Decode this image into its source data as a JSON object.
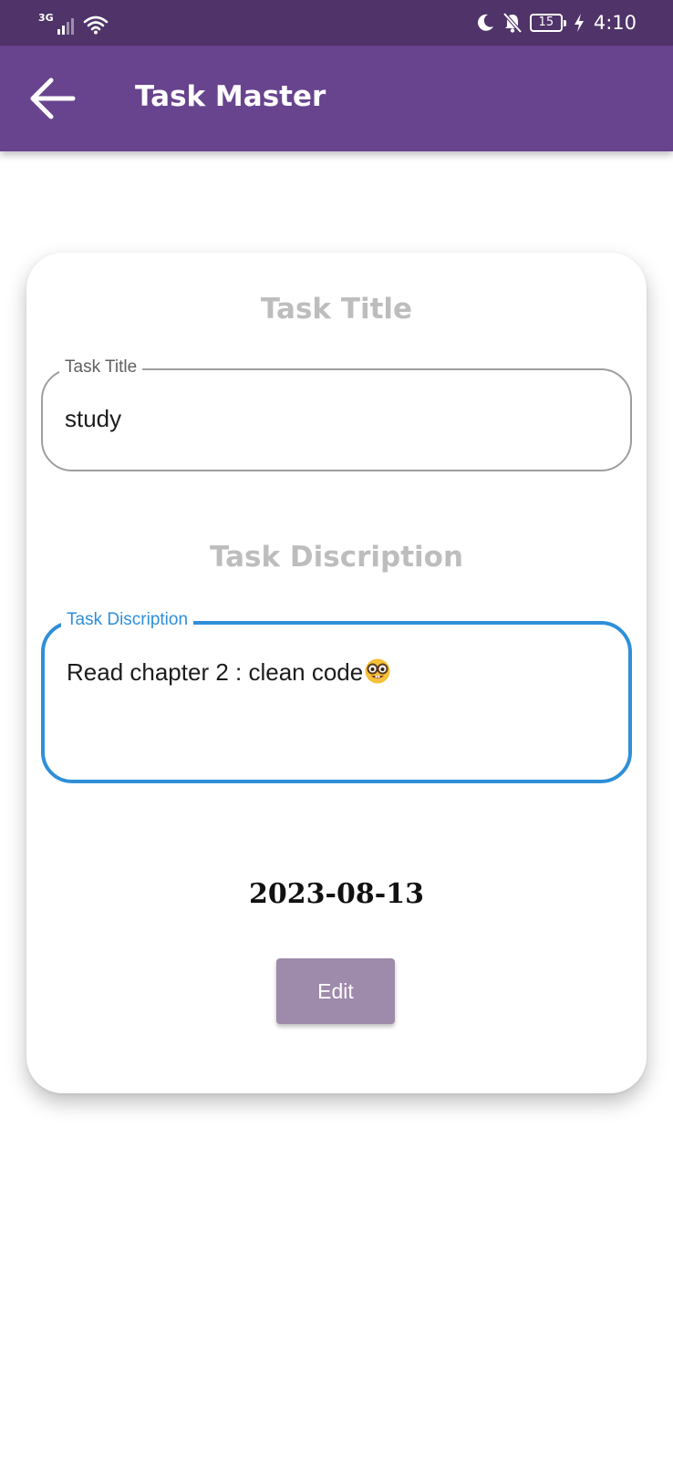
{
  "status_bar": {
    "network_type": "3G",
    "battery_level": "15",
    "time": "4:10",
    "icons": [
      "signal-icon",
      "wifi-icon",
      "moon-icon",
      "bell-off-icon",
      "battery-icon",
      "charging-icon"
    ]
  },
  "app_bar": {
    "title": "Task Master",
    "back_icon": "arrow-left-icon",
    "background": "#68438e"
  },
  "form": {
    "title_heading": "Task Title",
    "title_field": {
      "label": "Task Title",
      "value": "study"
    },
    "description_heading": "Task Discription",
    "description_field": {
      "label": "Task Discription",
      "value": "Read chapter 2 : clean code",
      "emoji": "nerd-face-emoji",
      "focused": true,
      "accent": "#2f8fd8"
    },
    "date": "2023-08-13",
    "edit_button_label": "Edit",
    "edit_button_color": "#9e8aab"
  }
}
